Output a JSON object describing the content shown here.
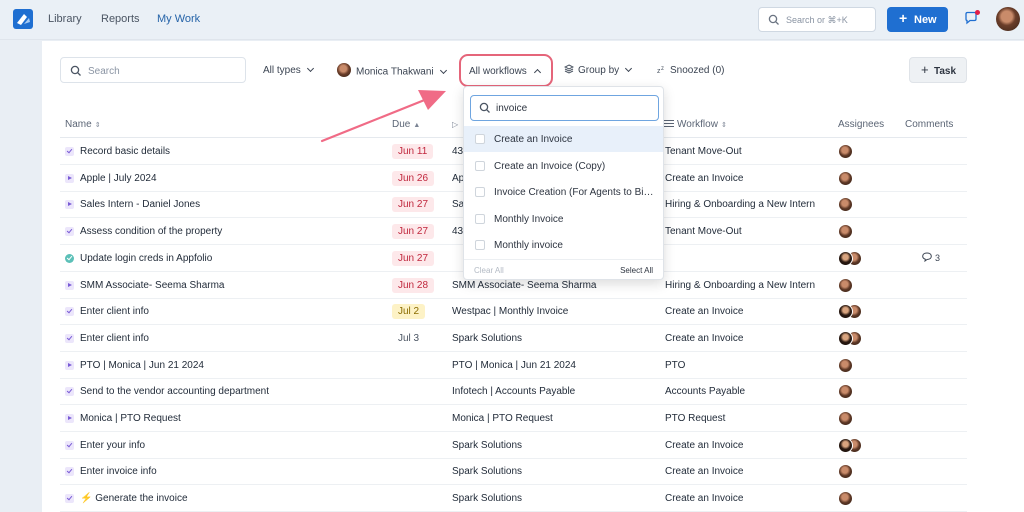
{
  "topbar": {
    "nav": [
      "Library",
      "Reports",
      "My Work"
    ],
    "search_placeholder": "Search or ⌘+K",
    "new_label": "New"
  },
  "toolbar": {
    "search_placeholder": "Search",
    "type_filter": "All types",
    "assignee_filter": "Monica Thakwani",
    "workflow_filter": "All workflows",
    "group_by": "Group by",
    "snoozed": "Snoozed (0)",
    "task_label": "Task"
  },
  "columns": {
    "name": "Name",
    "due": "Due",
    "workflow": "Workflow",
    "assignees": "Assignees",
    "comments": "Comments"
  },
  "rows": [
    {
      "name": "Record basic details",
      "due": "Jun 11",
      "due_style": "red",
      "pname": "43",
      "workflow": "Tenant Move-Out",
      "icon": "check",
      "assignees": 1,
      "comments": ""
    },
    {
      "name": "Apple | July 2024",
      "due": "Jun 26",
      "due_style": "red",
      "pname": "Ap",
      "workflow": "Create an Invoice",
      "icon": "play",
      "assignees": 1,
      "comments": ""
    },
    {
      "name": "Sales Intern - Daniel Jones",
      "due": "Jun 27",
      "due_style": "red",
      "pname": "Sa",
      "workflow": "Hiring & Onboarding a New Intern",
      "icon": "play",
      "assignees": 1,
      "comments": ""
    },
    {
      "name": "Assess condition of the property",
      "due": "Jun 27",
      "due_style": "red",
      "pname": "43",
      "workflow": "Tenant Move-Out",
      "icon": "check",
      "assignees": 1,
      "comments": ""
    },
    {
      "name": "Update login creds in Appfolio",
      "due": "Jun 27",
      "due_style": "red",
      "pname": "",
      "workflow": "",
      "icon": "done",
      "assignees": 2,
      "comments": "3"
    },
    {
      "name": "SMM Associate- Seema Sharma",
      "due": "Jun 28",
      "due_style": "red",
      "pname": "SMM Associate- Seema Sharma",
      "workflow": "Hiring & Onboarding a New Intern",
      "icon": "play",
      "assignees": 1,
      "comments": ""
    },
    {
      "name": "Enter client info",
      "due": "Jul 2",
      "due_style": "yellow",
      "pname": "Westpac | Monthly Invoice",
      "workflow": "Create an Invoice",
      "icon": "check",
      "assignees": 2,
      "comments": ""
    },
    {
      "name": "Enter client info",
      "due": "Jul 3",
      "due_style": "plain",
      "pname": "Spark Solutions",
      "workflow": "Create an Invoice",
      "icon": "check",
      "assignees": 2,
      "comments": ""
    },
    {
      "name": "PTO | Monica | Jun 21 2024",
      "due": "",
      "due_style": "plain",
      "pname": "PTO | Monica | Jun 21 2024",
      "workflow": "PTO",
      "icon": "play",
      "assignees": 1,
      "comments": ""
    },
    {
      "name": "Send to the vendor accounting department",
      "due": "",
      "due_style": "plain",
      "pname": "Infotech | Accounts Payable",
      "workflow": "Accounts Payable",
      "icon": "check",
      "assignees": 1,
      "comments": ""
    },
    {
      "name": "Monica | PTO Request",
      "due": "",
      "due_style": "plain",
      "pname": "Monica | PTO Request",
      "workflow": "PTO Request",
      "icon": "play",
      "assignees": 1,
      "comments": ""
    },
    {
      "name": "Enter your info",
      "due": "",
      "due_style": "plain",
      "pname": "Spark Solutions",
      "workflow": "Create an Invoice",
      "icon": "check",
      "assignees": 2,
      "comments": ""
    },
    {
      "name": "Enter invoice info",
      "due": "",
      "due_style": "plain",
      "pname": "Spark Solutions",
      "workflow": "Create an Invoice",
      "icon": "check",
      "assignees": 1,
      "comments": ""
    },
    {
      "name": "⚡ Generate the invoice",
      "due": "",
      "due_style": "plain",
      "pname": "Spark Solutions",
      "workflow": "Create an Invoice",
      "icon": "check",
      "assignees": 1,
      "comments": ""
    }
  ],
  "dropdown": {
    "search_value": "invoice",
    "options": [
      "Create an Invoice",
      "Create an Invoice (Copy)",
      "Invoice Creation (For Agents to Bill...",
      "Monthly Invoice",
      "Monthly invoice"
    ],
    "clear_all": "Clear All",
    "select_all": "Select All"
  },
  "colors": {
    "accent": "#1f6fd1",
    "highlight_ring": "#e5657a",
    "due_red_bg": "#fde8ea",
    "due_yellow_bg": "#fdf2c6"
  }
}
